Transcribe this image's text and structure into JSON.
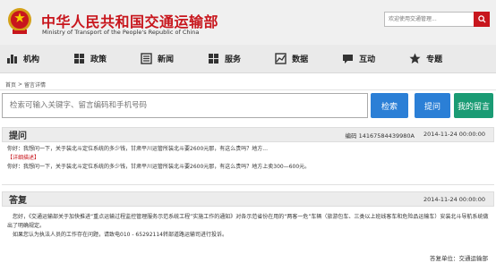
{
  "header": {
    "title": "中华人民共和国交通运输部",
    "subtitle": "Ministry of Transport of the People's Republic of China",
    "search_placeholder": "欢迎使用交通管理..."
  },
  "nav": {
    "items": [
      {
        "label": "机构",
        "icon": "org-icon"
      },
      {
        "label": "政策",
        "icon": "policy-icon"
      },
      {
        "label": "新闻",
        "icon": "news-icon"
      },
      {
        "label": "服务",
        "icon": "service-icon"
      },
      {
        "label": "数据",
        "icon": "data-icon"
      },
      {
        "label": "互动",
        "icon": "interact-icon"
      },
      {
        "label": "专题",
        "icon": "topic-icon"
      }
    ]
  },
  "breadcrumb": {
    "home": "首页",
    "sep": ">",
    "current": "留言详情"
  },
  "search": {
    "placeholder": "检索可输入关键字、留言编码和手机号码",
    "search_label": "检索",
    "ask_label": "提问",
    "mine_label": "我的留言"
  },
  "ask": {
    "title": "提问",
    "code": "编码 14167584439980A",
    "date": "2014-11-24 00:00:00",
    "summary": "你好：我想问一下，关于装北斗定位系统的多少钱，甘肃平川运管所装北斗要2600元那，有这么贵吗？地方...",
    "detail_label": "【详细描述】",
    "detail": "你好：我想问一下，关于装北斗定位系统的多少钱，甘肃平川运管所装北斗要2600元那，有这么贵吗？地方上卖300—600元。"
  },
  "reply": {
    "title": "答复",
    "date": "2014-11-24 00:00:00",
    "para1": "您好，《交通运输部关于加快推进“重点运输过程监控管理服务示范系统工程”实施工作的通知》对各示范省份在用的“两客一危”车辆（旅游包车、三类以上班线客车和危险品运输车）安装北斗导航系统做出了明确规定。",
    "para2": "如果您认为执法人员的工作存在问题，请致电010 - 65292114转部道路运输司进行投诉。",
    "unit": "答复单位：交通运输部"
  }
}
